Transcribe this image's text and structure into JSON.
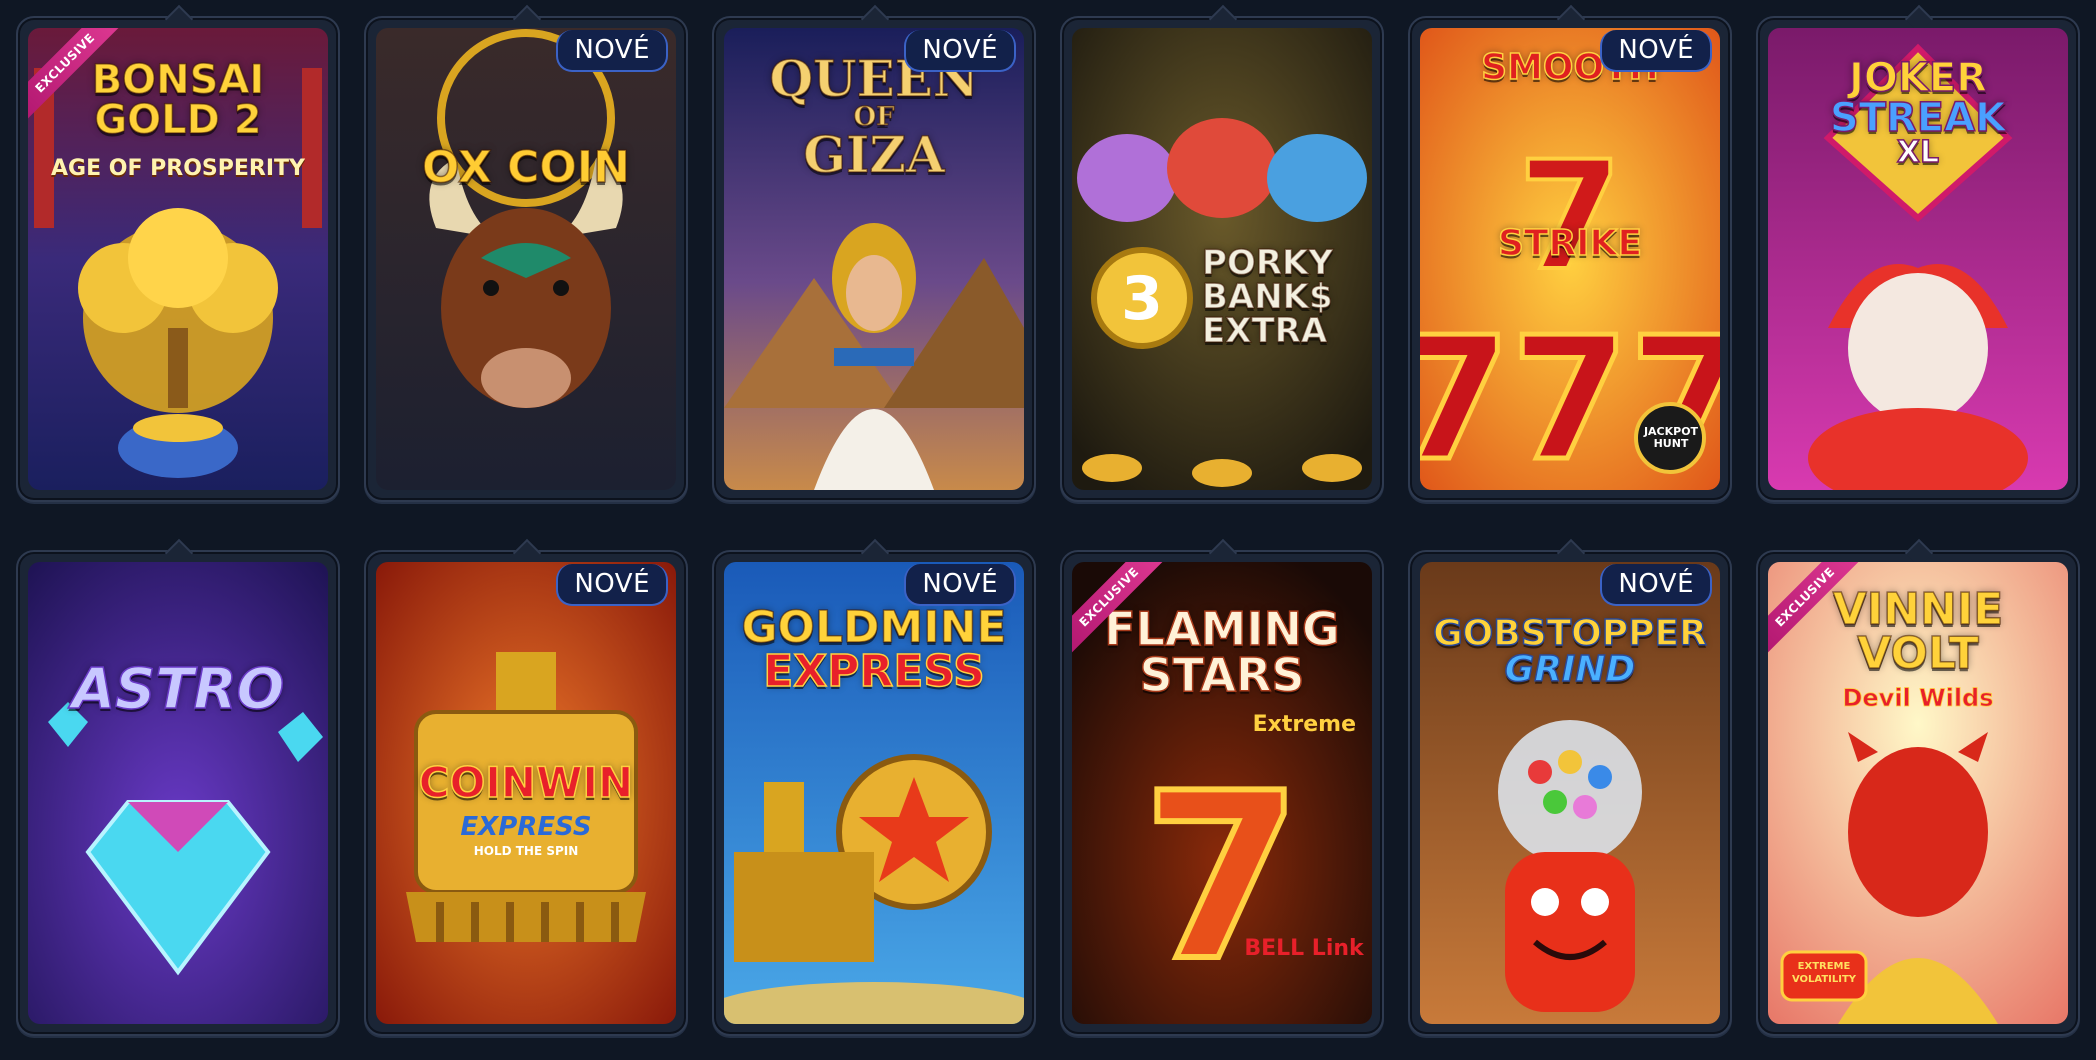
{
  "colors": {
    "page_bg": "#0f1724",
    "frame": "#1b2536",
    "badge_bg": "#12214a",
    "badge_border": "#3b62c6",
    "ribbon": "#d0237f"
  },
  "badges": {
    "new_label": "NOVÉ",
    "exclusive_label": "EXCLUSIVE"
  },
  "games": [
    {
      "title_lines": [
        "BONSAI",
        "GOLD 2"
      ],
      "subtitle": "AGE OF PROSPERITY",
      "badge": "exclusive",
      "theme": "bonsai-tree"
    },
    {
      "title_lines": [
        "OX COIN"
      ],
      "subtitle": "",
      "badge": "new",
      "theme": "bull"
    },
    {
      "title_lines": [
        "QUEEN",
        "OF",
        "GIZA"
      ],
      "subtitle": "",
      "badge": "new",
      "theme": "egyptian-queen"
    },
    {
      "title_lines": [
        "PORKY",
        "BANK$",
        "EXTRA"
      ],
      "subtitle": "3",
      "badge": "none",
      "theme": "piggy-banks"
    },
    {
      "title_lines": [
        "SMOOTH",
        "7's",
        "STRIKE"
      ],
      "subtitle": "JACKPOT HUNT",
      "badge": "new",
      "theme": "lucky-sevens"
    },
    {
      "title_lines": [
        "JOKER",
        "STREAK",
        "XL"
      ],
      "subtitle": "",
      "badge": "none",
      "theme": "jester"
    },
    {
      "title_lines": [
        "ASTRO"
      ],
      "subtitle": "",
      "badge": "none",
      "theme": "diamond"
    },
    {
      "title_lines": [
        "COINWIN"
      ],
      "subtitle": "EXPRESS",
      "tagline": "HOLD THE SPIN",
      "badge": "new",
      "theme": "gold-train"
    },
    {
      "title_lines": [
        "GOLDMINE",
        "EXPRESS"
      ],
      "subtitle": "",
      "badge": "new",
      "theme": "locomotive"
    },
    {
      "title_lines": [
        "FLAMING",
        "STARS"
      ],
      "subtitle": "Extreme",
      "tagline": "BELL Link",
      "badge": "exclusive",
      "theme": "flaming-seven"
    },
    {
      "title_lines": [
        "GOBSTOPPER",
        "GRIND"
      ],
      "subtitle": "",
      "badge": "new",
      "theme": "gumball-machine"
    },
    {
      "title_lines": [
        "VINNIE",
        "VOLT"
      ],
      "subtitle": "Devil Wilds",
      "tagline": "EXTREME VOLATILITY",
      "badge": "exclusive",
      "theme": "devil"
    }
  ]
}
